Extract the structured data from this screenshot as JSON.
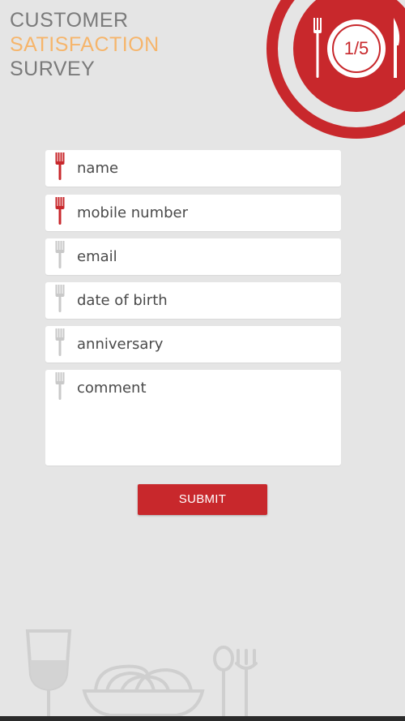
{
  "header": {
    "title_line1": "CUSTOMER",
    "title_line2": "SATISFACTION",
    "title_line3": "SURVEY"
  },
  "progress": {
    "label": "1/5",
    "current": 1,
    "total": 5
  },
  "form": {
    "fields": [
      {
        "placeholder": "name",
        "required": true,
        "icon": "fork-icon"
      },
      {
        "placeholder": "mobile number",
        "required": true,
        "icon": "fork-icon"
      },
      {
        "placeholder": "email",
        "required": false,
        "icon": "fork-icon"
      },
      {
        "placeholder": "date of birth",
        "required": false,
        "icon": "fork-icon"
      },
      {
        "placeholder": "anniversary",
        "required": false,
        "icon": "fork-icon"
      },
      {
        "placeholder": "comment",
        "required": false,
        "icon": "fork-icon"
      }
    ],
    "submit_label": "SUBMIT"
  },
  "colors": {
    "accent": "#c8282c",
    "title_highlight": "#f6b56b",
    "title_text": "#7a7a7a",
    "icon_inactive": "#c9c9c9",
    "background": "#e5e5e5"
  }
}
